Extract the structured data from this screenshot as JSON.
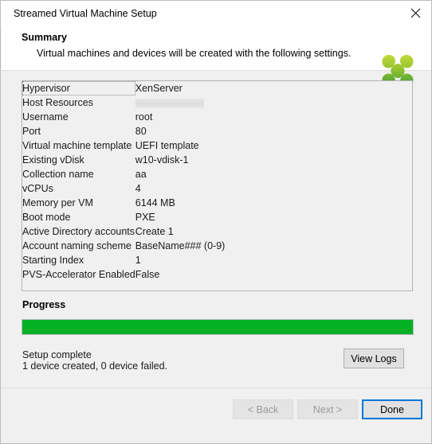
{
  "window": {
    "title": "Streamed Virtual Machine Setup",
    "close_icon": "close-icon"
  },
  "header": {
    "title": "Summary",
    "subtitle": "Virtual machines and devices will be created with the following settings.",
    "logo_icon": "citrix-logo-icon",
    "logo_colors": {
      "light": "#b9d42a",
      "mid": "#8bbf2a",
      "dark": "#3f9c35"
    }
  },
  "summary": {
    "rows": [
      {
        "label": "Hypervisor",
        "value": "XenServer",
        "redacted": false
      },
      {
        "label": "Host Resources",
        "value": "",
        "redacted": true
      },
      {
        "label": "Username",
        "value": "root",
        "redacted": false
      },
      {
        "label": "Port",
        "value": "80",
        "redacted": false
      },
      {
        "label": "Virtual machine template",
        "value": "UEFI template",
        "redacted": false
      },
      {
        "label": "Existing vDisk",
        "value": "w10-vdisk-1",
        "redacted": false
      },
      {
        "label": "Collection name",
        "value": "aa",
        "redacted": false
      },
      {
        "label": "vCPUs",
        "value": "4",
        "redacted": false
      },
      {
        "label": "Memory per VM",
        "value": "6144 MB",
        "redacted": false
      },
      {
        "label": "Boot mode",
        "value": "PXE",
        "redacted": false
      },
      {
        "label": "Active Directory accounts",
        "value": "Create 1",
        "redacted": false
      },
      {
        "label": "Account naming scheme",
        "value": "BaseName###  (0-9)",
        "redacted": false
      },
      {
        "label": "Starting Index",
        "value": "1",
        "redacted": false
      },
      {
        "label": "PVS-Accelerator Enabled",
        "value": "False",
        "redacted": false
      }
    ]
  },
  "progress": {
    "label": "Progress",
    "percent": 100,
    "bar_color": "#06b025",
    "status_line_1": "Setup complete",
    "status_line_2": "1 device created, 0 device failed.",
    "view_logs_label": "View Logs"
  },
  "footer": {
    "back_label": "< Back",
    "next_label": "Next >",
    "done_label": "Done",
    "focus_color": "#0078d7"
  }
}
